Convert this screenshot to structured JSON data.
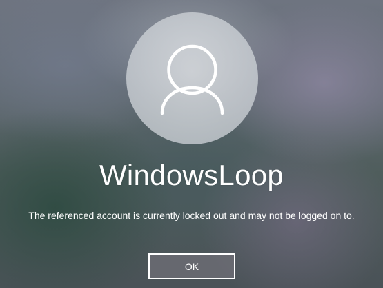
{
  "user": {
    "name": "WindowsLoop",
    "avatar_icon": "user-silhouette-icon"
  },
  "dialog": {
    "message": "The referenced account is currently locked out and may not be logged on to.",
    "ok_label": "OK"
  },
  "colors": {
    "text": "#ffffff",
    "button_border": "#ffffff"
  }
}
